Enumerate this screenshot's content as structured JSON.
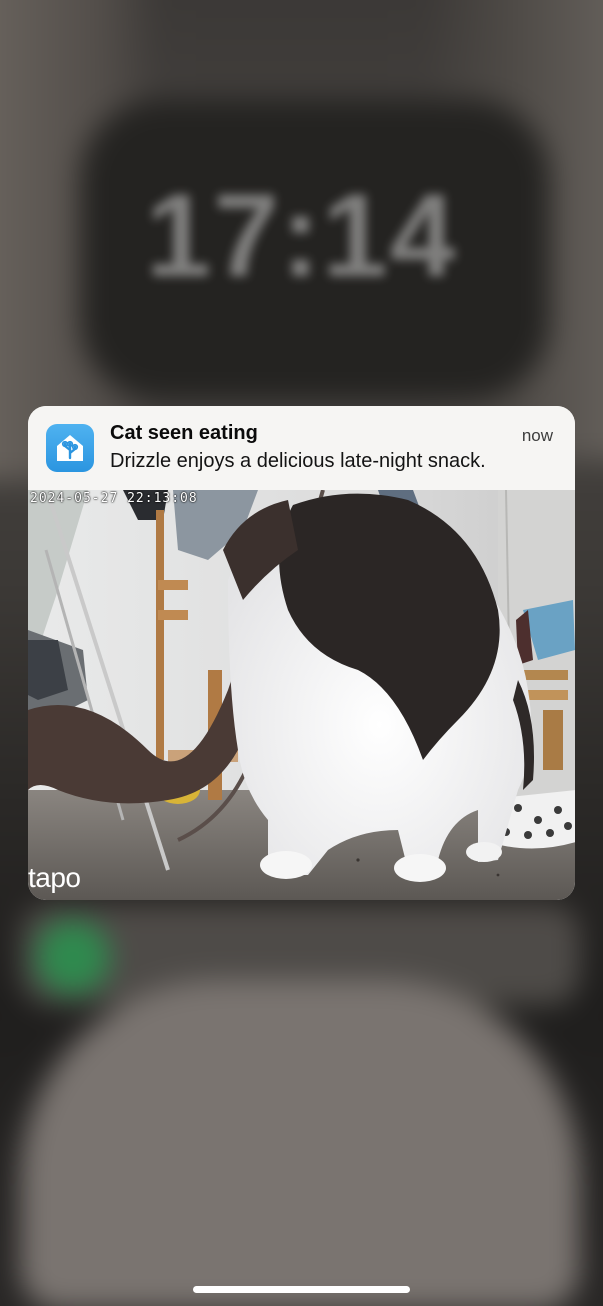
{
  "lockscreen": {
    "date_text": "",
    "time": "17:14"
  },
  "notification": {
    "app_icon": "home-app-icon",
    "title": "Cat seen eating",
    "time": "now",
    "body": "Drizzle enjoys a delicious late-night snack.",
    "accent_color": "#2b95e0"
  },
  "snapshot": {
    "timestamp": "2024-05-27 22:13:08",
    "watermark": "tapo"
  }
}
